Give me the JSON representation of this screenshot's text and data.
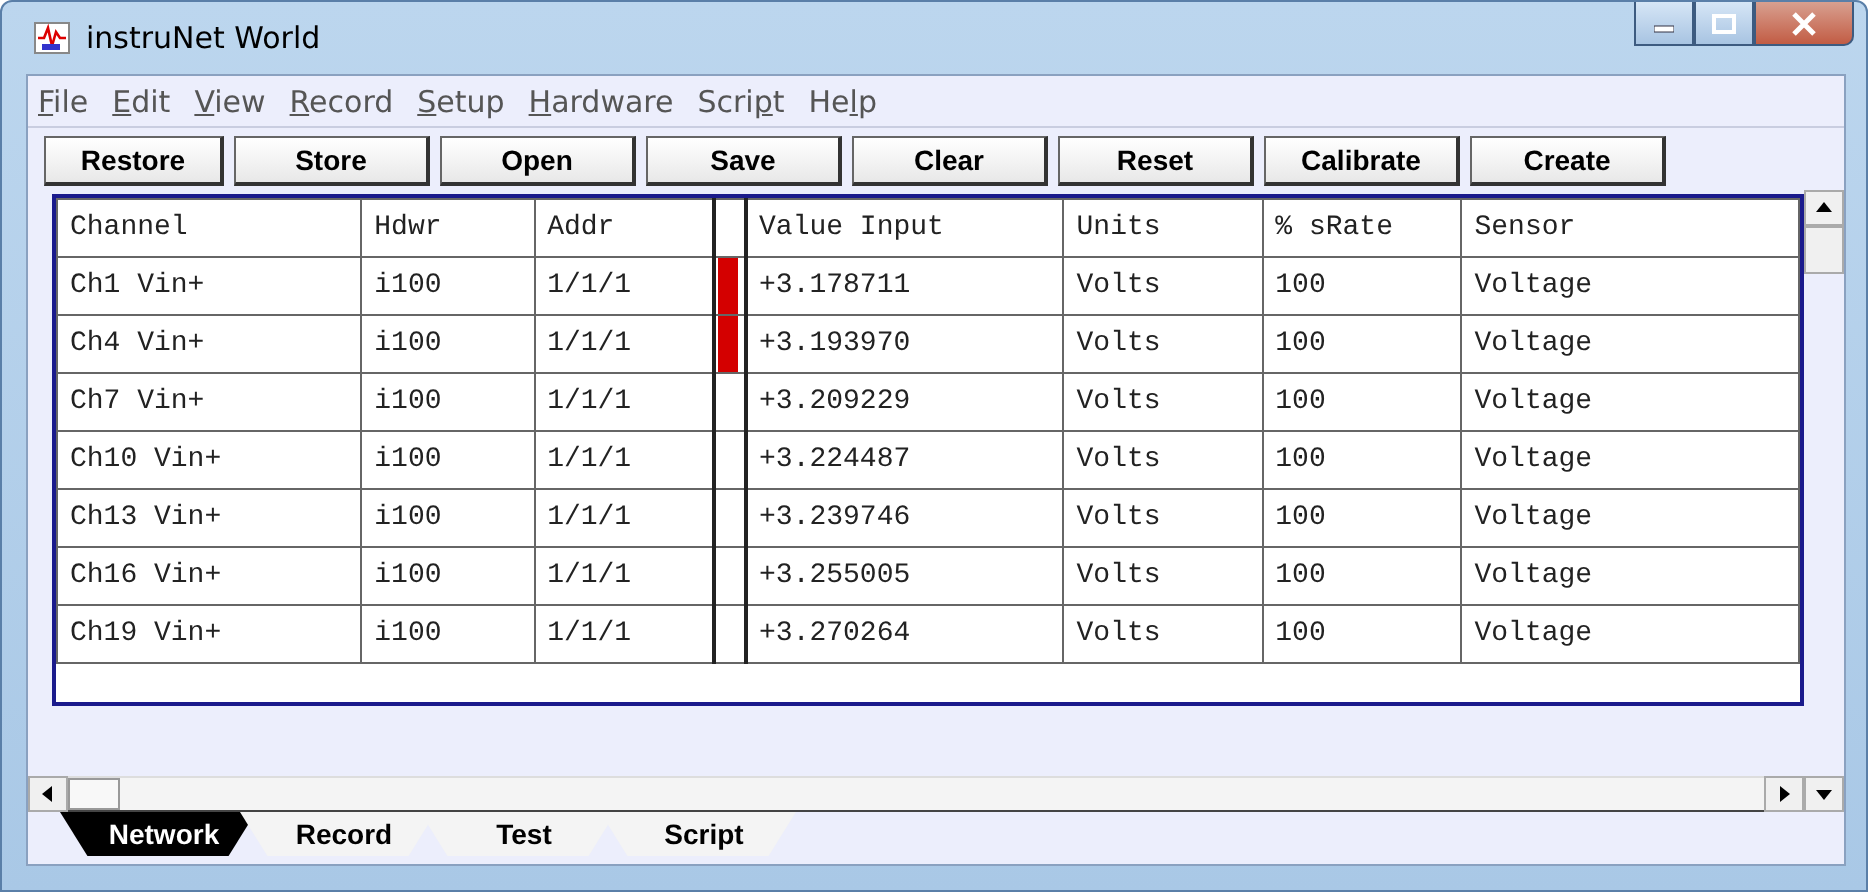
{
  "window": {
    "title": "instruNet World"
  },
  "menu": [
    {
      "key": "F",
      "after": "ile"
    },
    {
      "key": "E",
      "after": "dit"
    },
    {
      "key": "V",
      "after": "iew"
    },
    {
      "key": "R",
      "after": "ecord"
    },
    {
      "key": "S",
      "after": "etup"
    },
    {
      "key": "H",
      "after": "ardware"
    },
    {
      "before": "Scri",
      "key": "p",
      "after": "t"
    },
    {
      "before": "He",
      "key": "l",
      "after": "p"
    }
  ],
  "toolbar": [
    "Restore",
    "Store",
    "Open",
    "Save",
    "Clear",
    "Reset",
    "Calibrate",
    "Create"
  ],
  "table": {
    "columns": [
      "Channel",
      "Hdwr",
      "Addr",
      "Value Input",
      "Units",
      "% sRate",
      "Sensor"
    ],
    "rows": [
      {
        "channel": "Ch1 Vin+",
        "hdwr": "i100",
        "addr": "1/1/1",
        "active": true,
        "value": "+3.178711",
        "units": "Volts",
        "rate": "100",
        "sensor": "Voltage"
      },
      {
        "channel": "Ch4 Vin+",
        "hdwr": "i100",
        "addr": "1/1/1",
        "active": true,
        "value": "+3.193970",
        "units": "Volts",
        "rate": "100",
        "sensor": "Voltage"
      },
      {
        "channel": "Ch7 Vin+",
        "hdwr": "i100",
        "addr": "1/1/1",
        "active": false,
        "value": "+3.209229",
        "units": "Volts",
        "rate": "100",
        "sensor": "Voltage"
      },
      {
        "channel": "Ch10 Vin+",
        "hdwr": "i100",
        "addr": "1/1/1",
        "active": false,
        "value": "+3.224487",
        "units": "Volts",
        "rate": "100",
        "sensor": "Voltage"
      },
      {
        "channel": "Ch13 Vin+",
        "hdwr": "i100",
        "addr": "1/1/1",
        "active": false,
        "value": "+3.239746",
        "units": "Volts",
        "rate": "100",
        "sensor": "Voltage"
      },
      {
        "channel": "Ch16 Vin+",
        "hdwr": "i100",
        "addr": "1/1/1",
        "active": false,
        "value": "+3.255005",
        "units": "Volts",
        "rate": "100",
        "sensor": "Voltage"
      },
      {
        "channel": "Ch19 Vin+",
        "hdwr": "i100",
        "addr": "1/1/1",
        "active": false,
        "value": "+3.270264",
        "units": "Volts",
        "rate": "100",
        "sensor": "Voltage"
      }
    ]
  },
  "tabs": [
    {
      "label": "Network",
      "selected": true
    },
    {
      "label": "Record",
      "selected": false
    },
    {
      "label": "Test",
      "selected": false
    },
    {
      "label": "Script",
      "selected": false
    }
  ]
}
